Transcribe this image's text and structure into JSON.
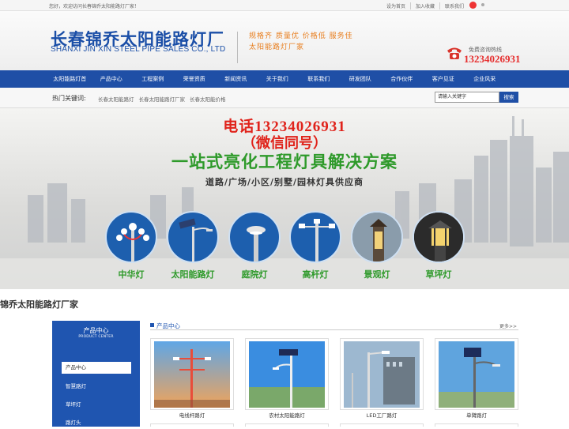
{
  "topbar": {
    "welcome": "您好，欢迎访问长春锦乔太阳能路灯厂家！",
    "links": [
      "设为首页",
      "加入收藏",
      "联系我们"
    ]
  },
  "header": {
    "logo_cn": "长春锦乔太阳能路灯厂",
    "logo_en": "SHANXI JIN XIN STEEL PIPE SALES CO., LTD",
    "slogan_line1": "规格齐  质量优  价格低  服务佳",
    "slogan_line2": "太阳能路灯厂家",
    "hotline_label": "免费咨询热线",
    "hotline_number": "13234026931"
  },
  "nav": {
    "items": [
      "太阳能路灯首",
      "产品中心",
      "工程案例",
      "荣誉资质",
      "新闻资讯",
      "关于我们",
      "联系我们",
      "研发团队",
      "合作伙伴",
      "客户见证",
      "企业风采"
    ]
  },
  "hotbar": {
    "label": "热门关键词:",
    "keywords": [
      "长春太阳能路灯",
      "长春太阳能路灯厂家",
      "长春太阳能价格"
    ],
    "search_placeholder": "请输入关键字",
    "search_button": "搜索"
  },
  "banner": {
    "phone": "电话13234026931",
    "wechat": "（微信同号）",
    "slogan": "一站式亮化工程灯具解决方案",
    "subtitle": "道路/广场/小区/别墅/园林灯具供应商",
    "categories": [
      "中华灯",
      "太阳能路灯",
      "庭院灯",
      "高杆灯",
      "景观灯",
      "草坪灯"
    ]
  },
  "section": {
    "title": "锦乔太阳能路灯厂家"
  },
  "sidebar": {
    "title_cn": "产品中心",
    "title_en": "PRODUCT CENTER",
    "items": [
      "产品中心",
      "智慧路灯",
      "草坪灯",
      "路灯头"
    ]
  },
  "products": {
    "header": "产品中心",
    "more": "更多>>",
    "items": [
      "电线杆路灯",
      "农村太阳能路灯",
      "LED工厂路灯",
      "单臂路灯"
    ]
  },
  "colors": {
    "nav_blue": "#1f4fa6",
    "hotline_red": "#e62e2e",
    "slogan_orange": "#e87e1e",
    "banner_green": "#2e9a2a"
  }
}
